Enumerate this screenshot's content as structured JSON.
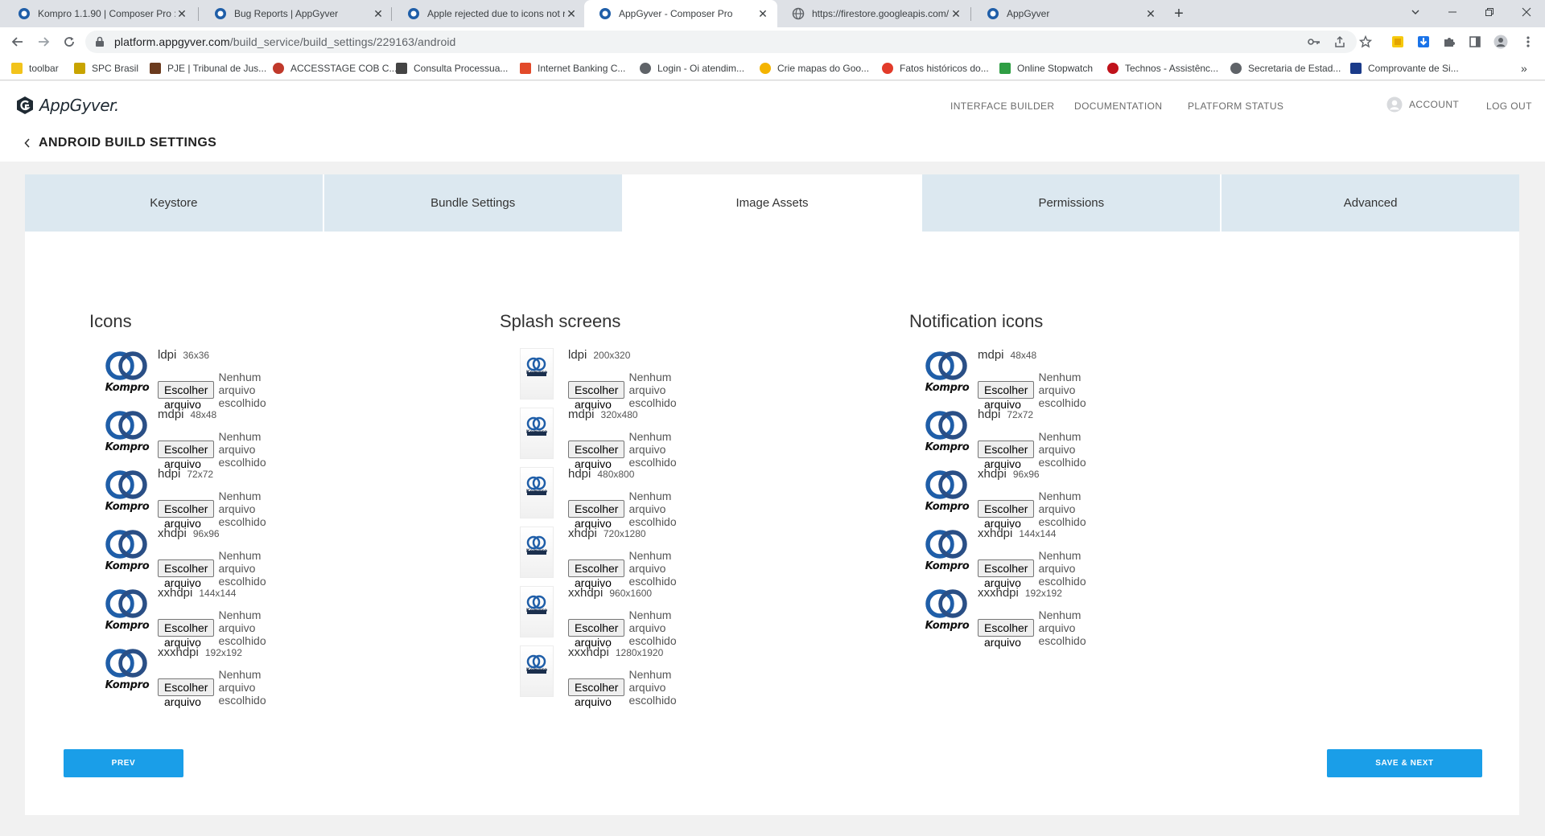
{
  "browser": {
    "tabs": [
      {
        "title": "Kompro 1.1.90 | Composer Pro :",
        "active": false
      },
      {
        "title": "Bug Reports | AppGyver",
        "active": false
      },
      {
        "title": "Apple rejected due to icons not r",
        "active": false
      },
      {
        "title": "AppGyver - Composer Pro",
        "active": true
      },
      {
        "title": "https://firestore.googleapis.com/",
        "active": false
      },
      {
        "title": "AppGyver",
        "active": false
      }
    ],
    "url_host": "platform.appgyver.com",
    "url_path": "/build_service/build_settings/229163/android",
    "bookmarks": [
      {
        "label": "toolbar",
        "color": "#f2c31b"
      },
      {
        "label": "SPC Brasil",
        "color": "#c8a400"
      },
      {
        "label": "PJE | Tribunal de Jus...",
        "color": "#6b3b1e"
      },
      {
        "label": "ACCESSTAGE COB C...",
        "color": "#c0392b"
      },
      {
        "label": "Consulta Processua...",
        "color": "#444444"
      },
      {
        "label": "Internet Banking C...",
        "color": "#e24a2a"
      },
      {
        "label": "Login - Oi atendim...",
        "color": "#5f6368"
      },
      {
        "label": "Crie mapas do Goo...",
        "color": "#f4b400"
      },
      {
        "label": "Fatos históricos do...",
        "color": "#e23b2a"
      },
      {
        "label": "Online Stopwatch",
        "color": "#2f9e44"
      },
      {
        "label": "Technos - Assistênc...",
        "color": "#c0121b"
      },
      {
        "label": "Secretaria de Estad...",
        "color": "#5f6368"
      },
      {
        "label": "Comprovante de Si...",
        "color": "#1b3b8a"
      }
    ]
  },
  "header": {
    "brand": "AppGyver.",
    "nav": [
      "INTERFACE BUILDER",
      "DOCUMENTATION",
      "PLATFORM STATUS"
    ],
    "account": "ACCOUNT",
    "logout": "LOG OUT",
    "page_title": "ANDROID BUILD SETTINGS"
  },
  "settings_tabs": [
    {
      "label": "Keystore",
      "active": false
    },
    {
      "label": "Bundle Settings",
      "active": false
    },
    {
      "label": "Image Assets",
      "active": true
    },
    {
      "label": "Permissions",
      "active": false
    },
    {
      "label": "Advanced",
      "active": false
    }
  ],
  "file_button_label": "Escolher arquivo",
  "no_file_label": "Nenhum arquivo escolhido",
  "logo_text": "Kompro",
  "sections": [
    {
      "title": "Icons",
      "kind": "icon",
      "items": [
        {
          "density": "ldpi",
          "size": "36x36"
        },
        {
          "density": "mdpi",
          "size": "48x48"
        },
        {
          "density": "hdpi",
          "size": "72x72"
        },
        {
          "density": "xhdpi",
          "size": "96x96"
        },
        {
          "density": "xxhdpi",
          "size": "144x144"
        },
        {
          "density": "xxxhdpi",
          "size": "192x192"
        }
      ]
    },
    {
      "title": "Splash screens",
      "kind": "splash",
      "items": [
        {
          "density": "ldpi",
          "size": "200x320"
        },
        {
          "density": "mdpi",
          "size": "320x480"
        },
        {
          "density": "hdpi",
          "size": "480x800"
        },
        {
          "density": "xhdpi",
          "size": "720x1280"
        },
        {
          "density": "xxhdpi",
          "size": "960x1600"
        },
        {
          "density": "xxxhdpi",
          "size": "1280x1920"
        }
      ]
    },
    {
      "title": "Notification icons",
      "kind": "icon",
      "items": [
        {
          "density": "mdpi",
          "size": "48x48"
        },
        {
          "density": "hdpi",
          "size": "72x72"
        },
        {
          "density": "xhdpi",
          "size": "96x96"
        },
        {
          "density": "xxhdpi",
          "size": "144x144"
        },
        {
          "density": "xxxhdpi",
          "size": "192x192"
        }
      ]
    }
  ],
  "buttons": {
    "prev": "PREV",
    "save_next": "SAVE & NEXT"
  },
  "colors": {
    "accent": "#1a9ee8",
    "tab_inactive": "#dce8f0",
    "logo_blue": "#1f5ea8"
  }
}
